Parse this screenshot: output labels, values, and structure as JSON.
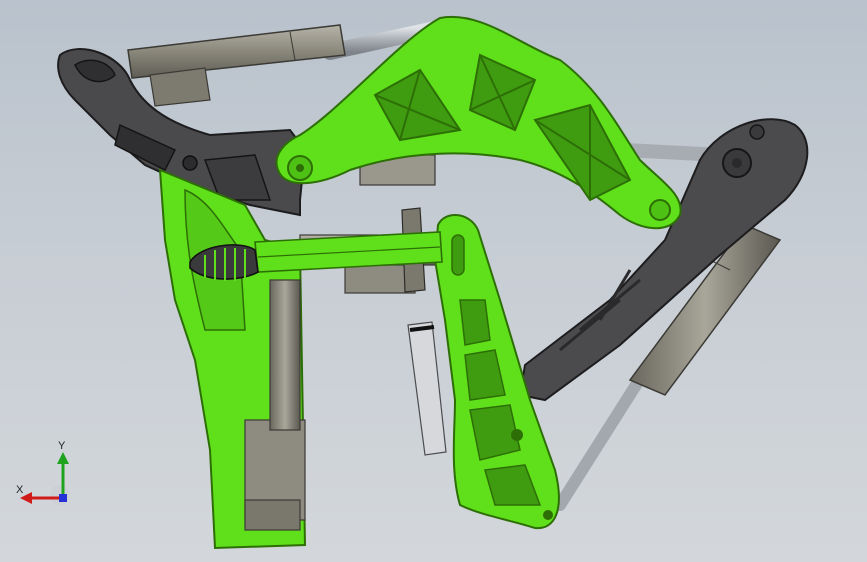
{
  "viewport": {
    "background_top": "#b9c2cc",
    "background_bottom": "#d3d7db"
  },
  "colors": {
    "green_part": "#5fe01a",
    "green_edge": "#2d6f06",
    "dark_part": "#4a4a4c",
    "dark_edge": "#1e1e20",
    "cylinder": "#8d8a7e",
    "rod": "#b4b8be"
  },
  "triad": {
    "x_label": "X",
    "y_label": "Y",
    "x_color": "#d11a1a",
    "y_color": "#1fa31f",
    "z_color": "#2530d8"
  }
}
